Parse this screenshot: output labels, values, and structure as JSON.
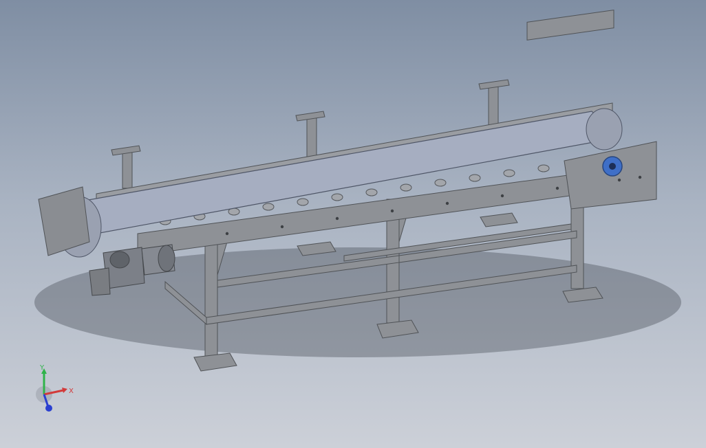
{
  "viewport": {
    "background_top": "#7f8ea3",
    "background_bottom": "#ccd0d8"
  },
  "model": {
    "frame_color": "#8e9196",
    "frame_dark": "#5a5d62",
    "belt_color": "#a6aec1",
    "motor_color": "#7c8088",
    "bearing_color": "#3f6fc7"
  },
  "triad": {
    "x_label": "X",
    "y_label": "Y",
    "x_color": "#d23a3a",
    "y_color": "#2fb34a",
    "z_color": "#2a3fd0"
  }
}
